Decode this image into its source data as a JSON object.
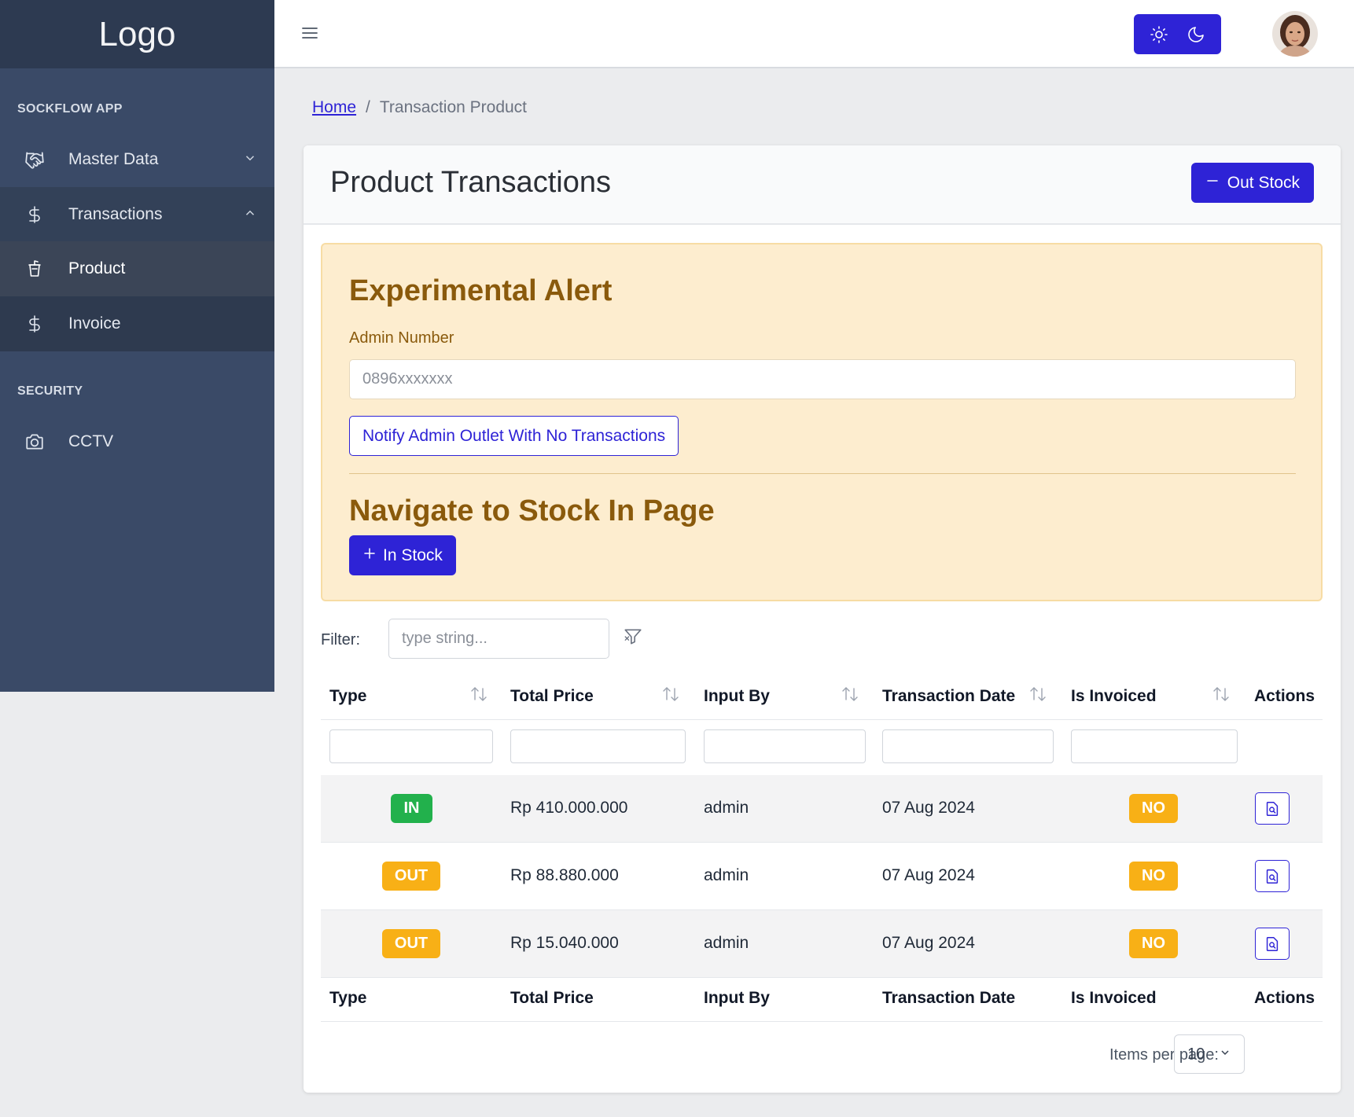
{
  "sidebar": {
    "logo": "Logo",
    "section_app": "SOCKFLOW APP",
    "items": [
      {
        "label": "Master Data",
        "icon": "handshake-icon"
      },
      {
        "label": "Transactions",
        "icon": "dollar-icon"
      },
      {
        "label": "Product",
        "icon": "cup-icon"
      },
      {
        "label": "Invoice",
        "icon": "dollar-icon"
      }
    ],
    "section_security": "SECURITY",
    "security_items": [
      {
        "label": "CCTV",
        "icon": "camera-icon"
      }
    ]
  },
  "topbar": {
    "menu_icon": "hamburger-icon",
    "theme_light_icon": "sun-icon",
    "theme_dark_icon": "moon-icon"
  },
  "breadcrumb": {
    "home": "Home",
    "separator": "/",
    "current": "Transaction Product"
  },
  "page": {
    "title": "Product Transactions",
    "out_stock_label": "Out Stock"
  },
  "alert": {
    "title": "Experimental Alert",
    "admin_label": "Admin Number",
    "admin_placeholder": "0896xxxxxxx",
    "notify_label": "Notify Admin Outlet With No Transactions",
    "title2": "Navigate to Stock In Page",
    "in_stock_label": "In Stock"
  },
  "filter": {
    "label": "Filter:",
    "placeholder": "type string..."
  },
  "table": {
    "columns": [
      "Type",
      "Total Price",
      "Input By",
      "Transaction Date",
      "Is Invoiced",
      "Actions"
    ],
    "rows": [
      {
        "type": "IN",
        "total_price": "Rp 410.000.000",
        "input_by": "admin",
        "date": "07 Aug 2024",
        "invoiced": "NO"
      },
      {
        "type": "OUT",
        "total_price": "Rp 88.880.000",
        "input_by": "admin",
        "date": "07 Aug 2024",
        "invoiced": "NO"
      },
      {
        "type": "OUT",
        "total_price": "Rp 15.040.000",
        "input_by": "admin",
        "date": "07 Aug 2024",
        "invoiced": "NO"
      }
    ]
  },
  "pagination": {
    "items_per_page_label": "Items per page:",
    "items_per_page": "10"
  },
  "colors": {
    "primary": "#2e23d6",
    "sidebar": "#3a4a67",
    "alert_bg": "#fdedcf",
    "success": "#22b14c",
    "warning": "#f8b016"
  }
}
